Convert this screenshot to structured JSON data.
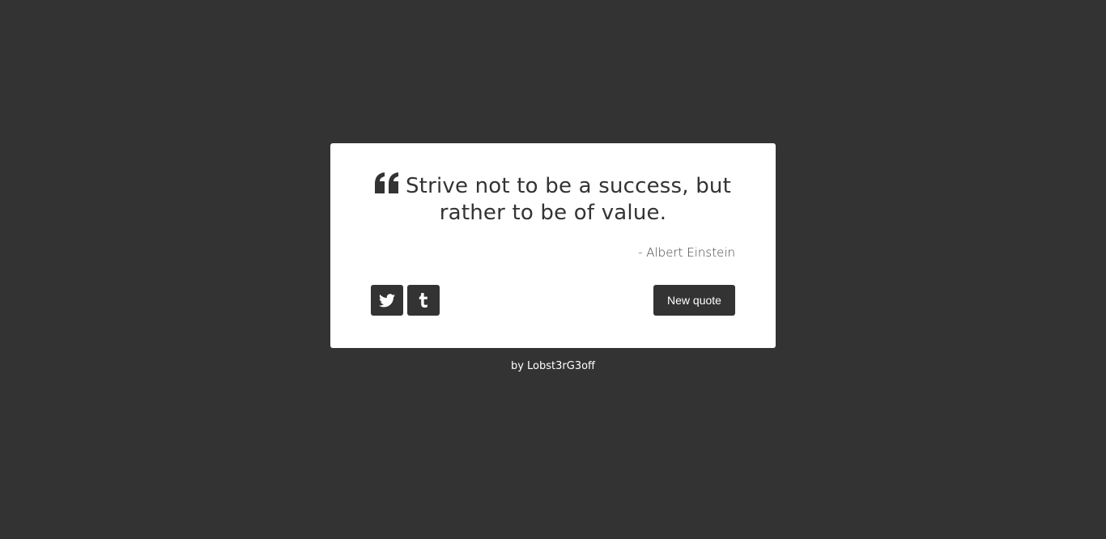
{
  "quote": {
    "text": "Strive not to be a success, but rather to be of value.",
    "author": "- Albert Einstein",
    "icon": "quote-left-icon"
  },
  "actions": {
    "twitter_icon": "twitter-icon",
    "tumblr_icon": "tumblr-icon",
    "new_quote_label": "New quote"
  },
  "footer": {
    "prefix": "by ",
    "author_link": "Lobst3rG3off"
  },
  "colors": {
    "background": "#333333",
    "card": "#ffffff",
    "button": "#333333",
    "text": "#333333"
  }
}
